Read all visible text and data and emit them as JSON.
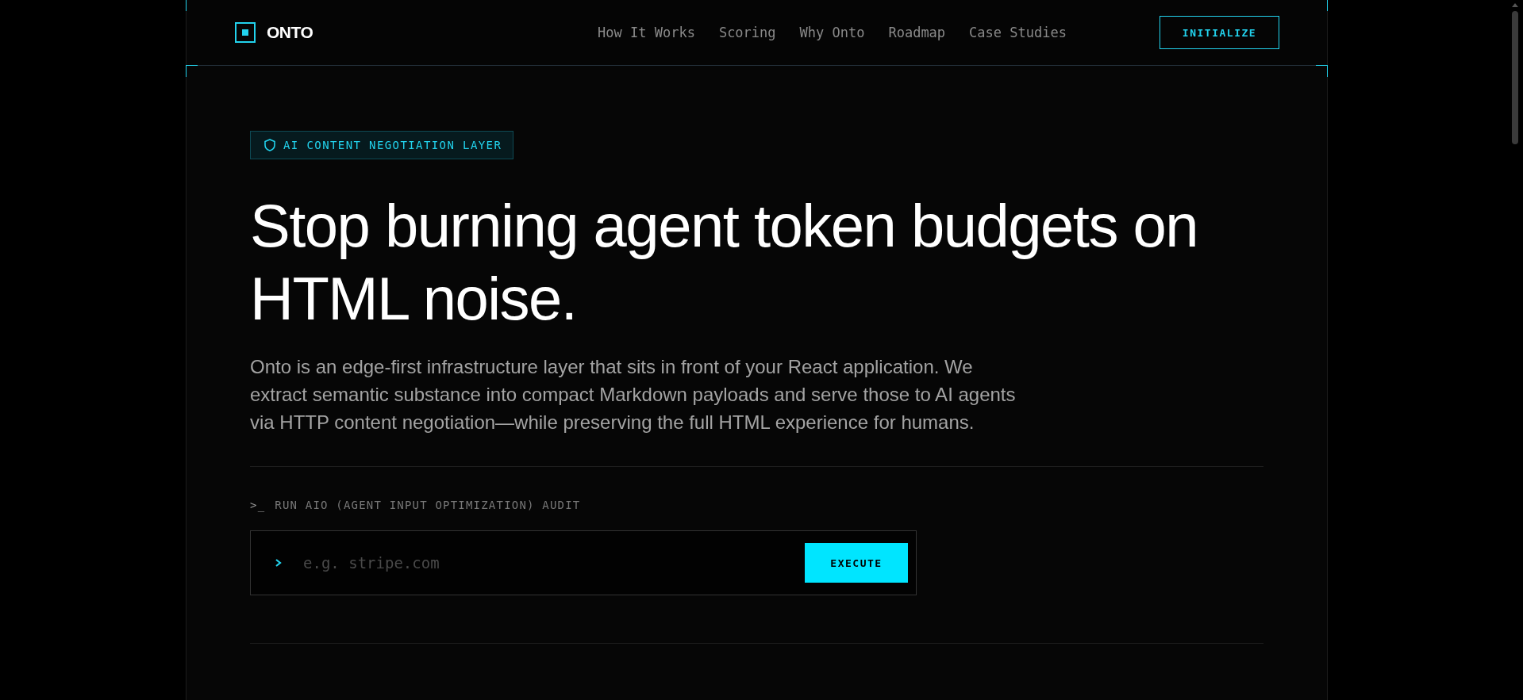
{
  "header": {
    "logo": "ONTO",
    "nav": [
      {
        "label": "How It Works"
      },
      {
        "label": "Scoring"
      },
      {
        "label": "Why Onto"
      },
      {
        "label": "Roadmap"
      },
      {
        "label": "Case Studies"
      }
    ],
    "cta": "INITIALIZE"
  },
  "hero": {
    "badge": "AI CONTENT NEGOTIATION LAYER",
    "heading": "Stop burning agent token budgets on HTML noise.",
    "description": "Onto is an edge-first infrastructure layer that sits in front of your React application. We extract semantic substance into compact Markdown payloads and serve those to AI agents via HTTP content negotiation—while preserving the full HTML experience for humans."
  },
  "audit": {
    "prompt": ">_",
    "label": "RUN AIO (AGENT INPUT OPTIMIZATION) AUDIT",
    "placeholder": "e.g. stripe.com",
    "button": "EXECUTE"
  }
}
